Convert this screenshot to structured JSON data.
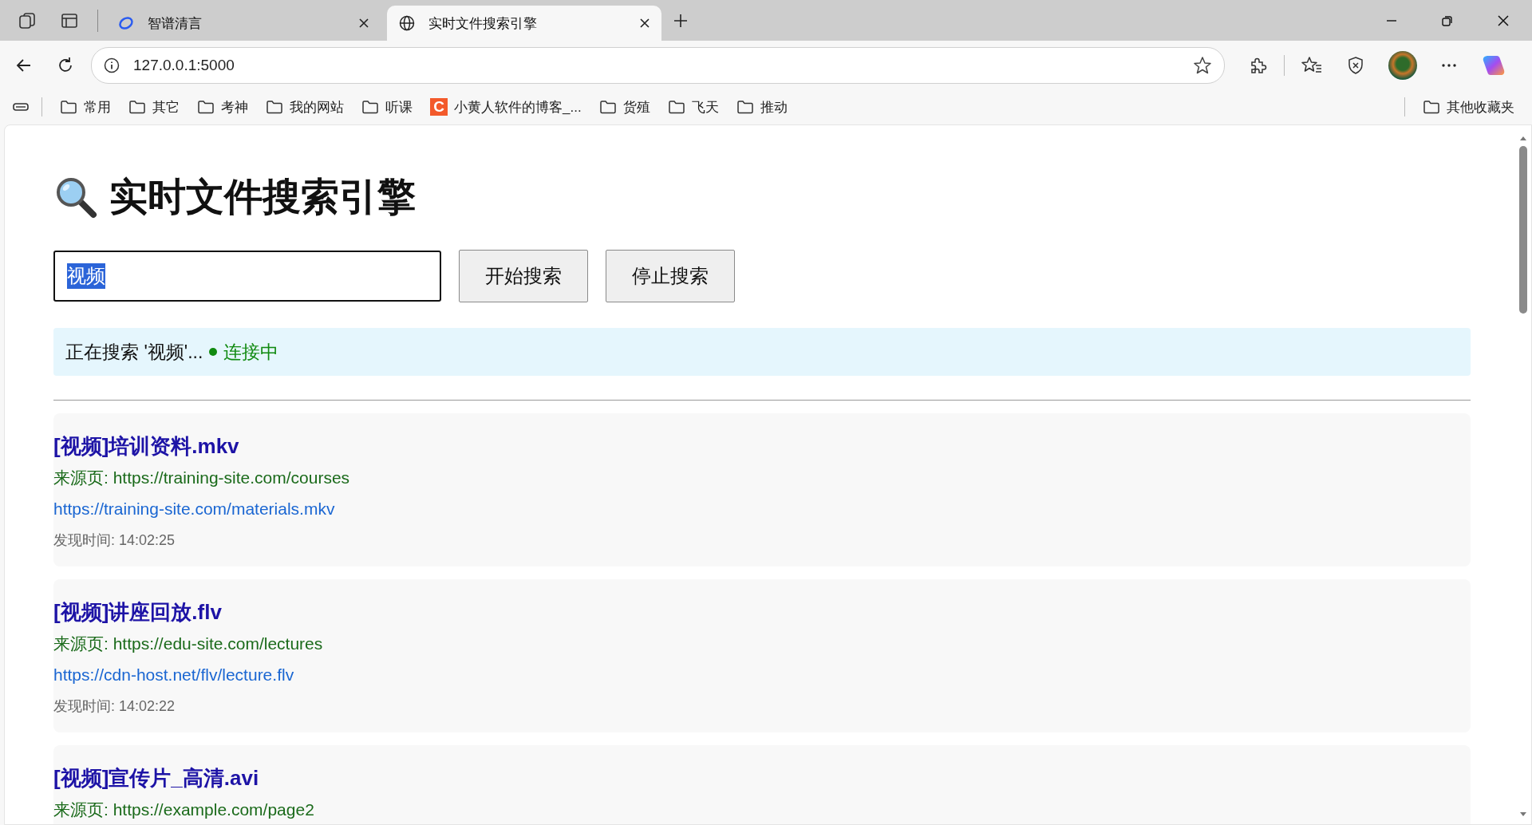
{
  "tabs": [
    {
      "title": "智谱清言",
      "kind": "assistant",
      "selected": false
    },
    {
      "title": "实时文件搜索引擎",
      "kind": "web",
      "selected": true
    }
  ],
  "address": "127.0.0.1:5000",
  "bookmarks": [
    {
      "kind": "folder",
      "label": "常用"
    },
    {
      "kind": "folder",
      "label": "其它"
    },
    {
      "kind": "folder",
      "label": "考神"
    },
    {
      "kind": "folder",
      "label": "我的网站"
    },
    {
      "kind": "folder",
      "label": "听课"
    },
    {
      "kind": "site",
      "label": "小黄人软件的博客_...",
      "badge": "C"
    },
    {
      "kind": "folder",
      "label": "货殖"
    },
    {
      "kind": "folder",
      "label": "飞天"
    },
    {
      "kind": "folder",
      "label": "推动"
    }
  ],
  "other_bookmarks": "其他收藏夹",
  "page": {
    "title": "实时文件搜索引擎",
    "search": {
      "value": "视频",
      "value_selected": true
    },
    "buttons": [
      "开始搜索",
      "停止搜索"
    ],
    "status": {
      "text": "正在搜索 '视频'...",
      "color": "#108a10",
      "connection": "连接中"
    },
    "results": [
      {
        "title": "[视频]培训资料.mkv",
        "source": "来源页: https://training-site.com/courses",
        "link": "https://training-site.com/materials.mkv",
        "found": "发现时间: 14:02:25"
      },
      {
        "title": "[视频]讲座回放.flv",
        "source": "来源页: https://edu-site.com/lectures",
        "link": "https://cdn-host.net/flv/lecture.flv",
        "found": "发现时间: 14:02:22"
      },
      {
        "title": "[视频]宣传片_高清.avi",
        "source": "来源页: https://example.com/page2"
      }
    ]
  }
}
